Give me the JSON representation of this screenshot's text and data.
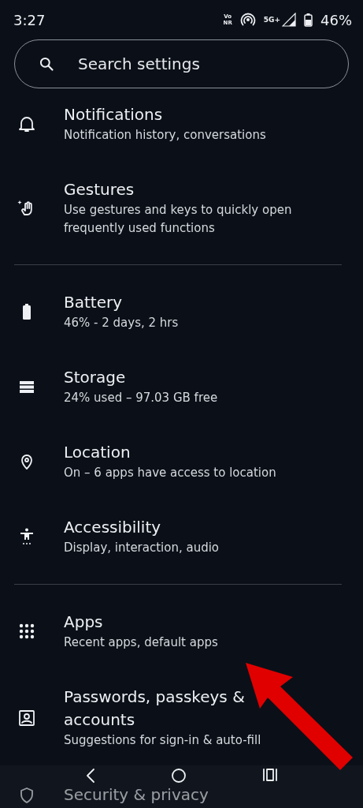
{
  "status_bar": {
    "time": "3:27",
    "voice_badge": [
      "Vo",
      "NR"
    ],
    "network": "5G+",
    "battery": "46%"
  },
  "search": {
    "placeholder": "Search settings"
  },
  "items": [
    {
      "title": "Notifications",
      "subtitle": "Notification history, conversations",
      "divider_after": false
    },
    {
      "title": "Gestures",
      "subtitle": "Use gestures and keys to quickly open frequently used functions",
      "divider_after": true
    },
    {
      "title": "Battery",
      "subtitle": "46% - 2 days, 2 hrs",
      "divider_after": false
    },
    {
      "title": "Storage",
      "subtitle": "24% used – 97.03 GB free",
      "divider_after": false
    },
    {
      "title": "Location",
      "subtitle": "On – 6 apps have access to location",
      "divider_after": false
    },
    {
      "title": "Accessibility",
      "subtitle": "Display, interaction, audio",
      "divider_after": true
    },
    {
      "title": "Apps",
      "subtitle": "Recent apps, default apps",
      "divider_after": false
    },
    {
      "title": "Passwords, passkeys & accounts",
      "subtitle": "Suggestions for sign-in & auto-fill",
      "divider_after": false
    },
    {
      "title": "Security & privacy",
      "divider_after": false
    }
  ]
}
